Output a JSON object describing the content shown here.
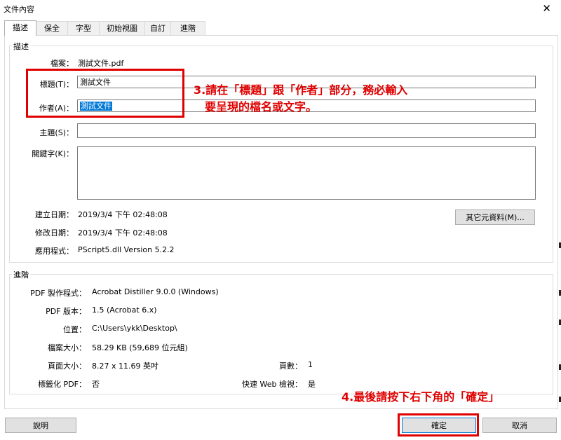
{
  "window": {
    "title": "文件內容"
  },
  "tabs": [
    "描述",
    "保全",
    "字型",
    "初始視圖",
    "自訂",
    "進階"
  ],
  "description": {
    "group_label": "描述",
    "file_label": "檔案：",
    "file_value": "測試文件.pdf",
    "title_label": "標題(T)：",
    "title_value": "測試文件",
    "author_label": "作者(A)：",
    "author_value": "測試文件",
    "subject_label": "主題(S)：",
    "subject_value": "",
    "keywords_label": "關鍵字(K)：",
    "keywords_value": "",
    "created_label": "建立日期：",
    "created_value": "2019/3/4 下午 02:48:08",
    "modified_label": "修改日期：",
    "modified_value": "2019/3/4 下午 02:48:08",
    "app_label": "應用程式：",
    "app_value": "PScript5.dll Version 5.2.2",
    "metadata_button": "其它元資料(M)..."
  },
  "advanced": {
    "group_label": "進階",
    "producer_label": "PDF 製作程式：",
    "producer_value": "Acrobat Distiller 9.0.0 (Windows)",
    "version_label": "PDF 版本：",
    "version_value": "1.5 (Acrobat 6.x)",
    "location_label": "位置：",
    "location_value": "C:\\Users\\ykk\\Desktop\\",
    "filesize_label": "檔案大小：",
    "filesize_value": "58.29 KB (59,689 位元組)",
    "pagesize_label": "頁面大小：",
    "pagesize_value": "8.27 x 11.69 英吋",
    "pages_label": "頁數：",
    "pages_value": "1",
    "tagged_label": "標籤化 PDF：",
    "tagged_value": "否",
    "fastweb_label": "快速 Web 檢視：",
    "fastweb_value": "是"
  },
  "buttons": {
    "help": "說明",
    "ok": "確定",
    "cancel": "取消"
  },
  "annotations": {
    "note3_line1": "3.請在「標題」跟「作者」部分，務必輸入",
    "note3_line2": "要呈現的檔名或文字。",
    "note4": "4.最後請按下右下角的「確定」"
  },
  "colors": {
    "annotation": "#e00000",
    "selection": "#0078d7"
  }
}
